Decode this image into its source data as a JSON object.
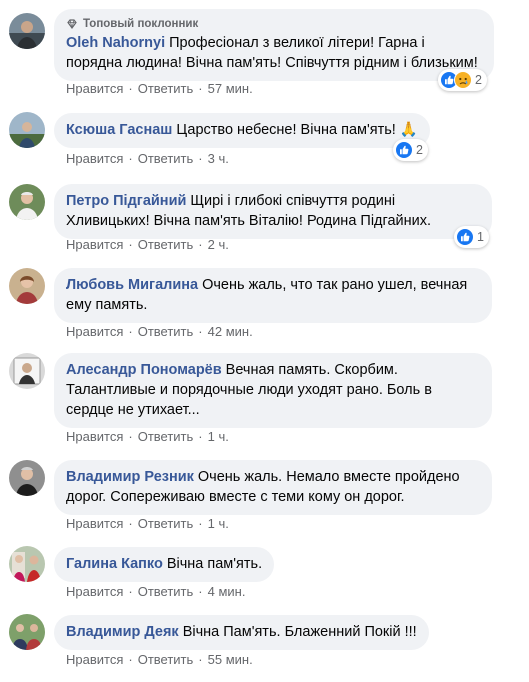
{
  "actions": {
    "like": "Нравится",
    "reply": "Ответить",
    "separator": "·"
  },
  "badge": {
    "top_fan": "Топовый поклонник"
  },
  "colors": {
    "author": "#385898",
    "bubble": "#f0f2f5",
    "meta": "#65676b",
    "like_blue": "#1877f2",
    "pray_yellow": "#f7b125"
  },
  "comments": [
    {
      "author": "Oleh Nahornyi",
      "text": "Професіонал з великої літери! Гарна і порядна людина! Вічна пам'ять! Співчуття рідним і близьким!",
      "time": "57 мин.",
      "top_fan": true,
      "reactions": {
        "icons": [
          "like-icon",
          "sad-icon"
        ],
        "count": "2"
      }
    },
    {
      "author": "Ксюша Гаснаш",
      "text": "Царство небесне! Вічна пам'ять! 🙏",
      "time": "3 ч.",
      "reactions": {
        "icons": [
          "like-icon"
        ],
        "count": "2"
      }
    },
    {
      "author": "Петро Підгайний",
      "text": "Щирі і глибокі співчуття родині Хливицьких! Вічна пам'ять Віталію! Родина Підгайних.",
      "time": "2 ч.",
      "reactions": {
        "icons": [
          "like-icon"
        ],
        "count": "1"
      }
    },
    {
      "author": "Любовь Мигалина",
      "text": "Очень жаль, что так рано ушел, вечная ему память.",
      "time": "42 мин."
    },
    {
      "author": "Алесандр Пономарёв",
      "text": "Вечная память. Скорбим. Талантливые и порядочные люди уходят рано. Боль в сердце не утихает...",
      "time": "1 ч."
    },
    {
      "author": "Владимир Резник",
      "text": "Очень жаль. Немало вместе пройдено дорог. Сопереживаю вместе с теми кому он дорог.",
      "time": "1 ч."
    },
    {
      "author": "Галина Капко",
      "text": "Вічна пам'ять.",
      "time": "4 мин."
    },
    {
      "author": "Владимир Деяк",
      "text": "Вічна Пам'ять. Блаженний Покій !!!",
      "time": "55 мин."
    }
  ]
}
